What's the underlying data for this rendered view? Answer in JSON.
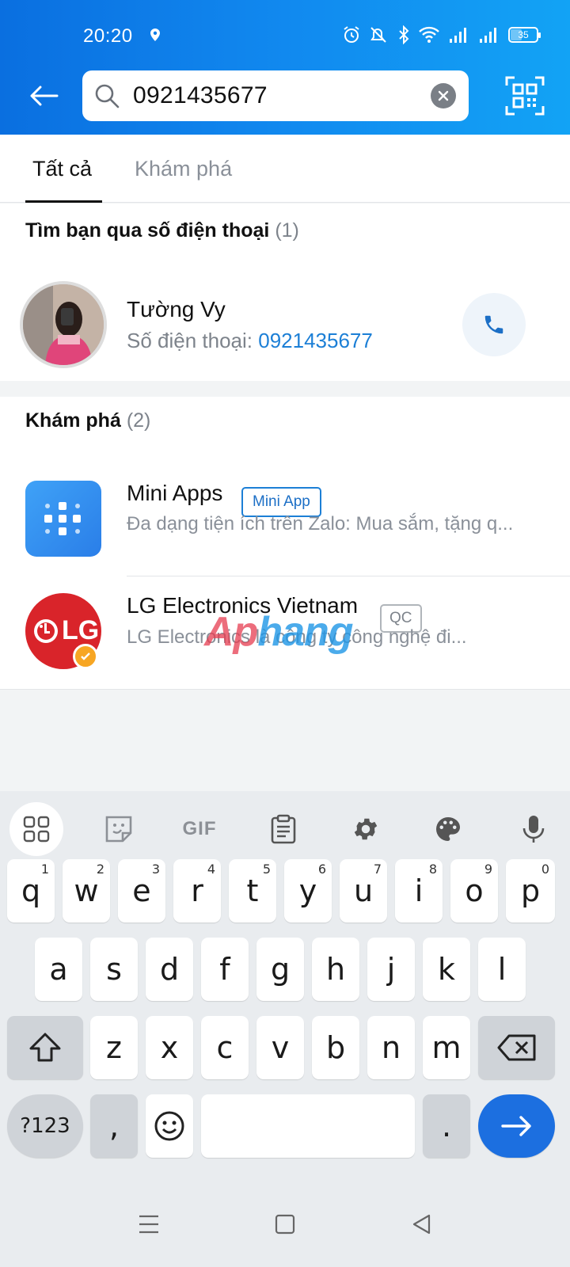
{
  "status_bar": {
    "time": "20:20",
    "battery": "35"
  },
  "search": {
    "value": "0921435677",
    "placeholder": ""
  },
  "tabs": [
    {
      "label": "Tất cả",
      "active": true
    },
    {
      "label": "Khám phá",
      "active": false
    }
  ],
  "phone_section": {
    "title": "Tìm bạn qua số điện thoại",
    "count": "(1)",
    "contact": {
      "name": "Tường Vy",
      "phone_label": "Số điện thoại:",
      "phone": "0921435677"
    }
  },
  "explore_section": {
    "title": "Khám phá",
    "count": "(2)",
    "items": [
      {
        "title": "Mini Apps",
        "badge": "Mini App",
        "desc": "Đa dạng tiện ích trên Zalo: Mua sắm, tặng q..."
      },
      {
        "title": "LG Electronics Vietnam",
        "badge": "QC",
        "desc": "LG Electronics là công ty công nghệ đi...",
        "logo_text": "LG"
      }
    ]
  },
  "watermark": {
    "part1": "Ap",
    "part2": "hang"
  },
  "keyboard": {
    "toolbar": [
      "apps-grid-icon",
      "sticker-icon",
      "GIF",
      "clipboard-icon",
      "settings-icon",
      "palette-icon",
      "microphone-icon"
    ],
    "row1": [
      {
        "k": "q",
        "h": "1"
      },
      {
        "k": "w",
        "h": "2"
      },
      {
        "k": "e",
        "h": "3"
      },
      {
        "k": "r",
        "h": "4"
      },
      {
        "k": "t",
        "h": "5"
      },
      {
        "k": "y",
        "h": "6"
      },
      {
        "k": "u",
        "h": "7"
      },
      {
        "k": "i",
        "h": "8"
      },
      {
        "k": "o",
        "h": "9"
      },
      {
        "k": "p",
        "h": "0"
      }
    ],
    "row2": [
      "a",
      "s",
      "d",
      "f",
      "g",
      "h",
      "j",
      "k",
      "l"
    ],
    "row3": [
      "z",
      "x",
      "c",
      "v",
      "b",
      "n",
      "m"
    ],
    "sym_label": "?123",
    "comma": ",",
    "period": "."
  },
  "colors": {
    "header_start": "#0a6fe0",
    "header_end": "#12a3f5",
    "link": "#1c7fd6",
    "enter": "#1c6fe0"
  }
}
